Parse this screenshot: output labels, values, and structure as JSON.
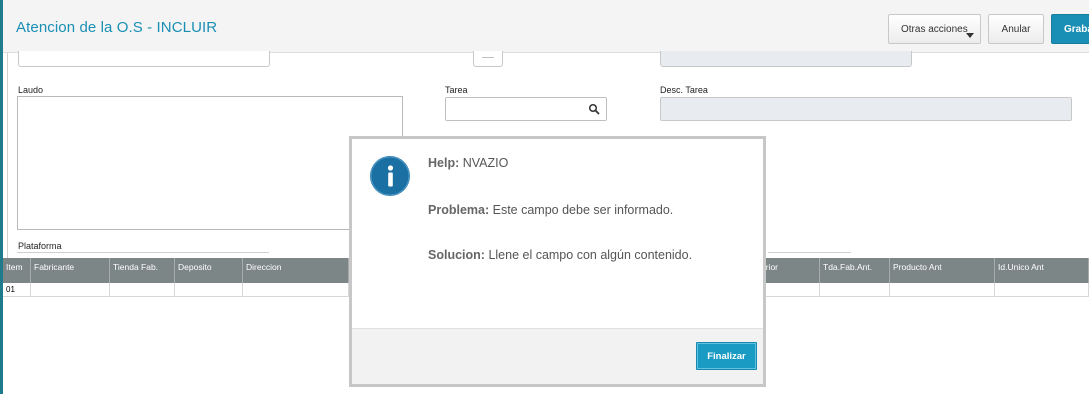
{
  "header": {
    "title": "Atencion de la O.S - INCLUIR",
    "otras_acciones_label": "Otras acciones",
    "anular_label": "Anular",
    "grabar_label": "Graba"
  },
  "form": {
    "top_field_value": "___",
    "laudo_label": "Laudo",
    "tarea_label": "Tarea",
    "tarea_value": "",
    "desc_tarea_label": "Desc. Tarea",
    "desc_tarea_value": "",
    "plataforma_label": "Plataforma"
  },
  "grid": {
    "columns": [
      "Item",
      "Fabricante",
      "Tienda Fab.",
      "Deposito",
      "Direccion",
      "erior",
      "Tda.Fab.Ant.",
      "Producto Ant",
      "Id.Unico Ant"
    ],
    "rows": [
      {
        "item": "01"
      }
    ]
  },
  "modal": {
    "help_label": "Help:",
    "help_value": "NVAZIO",
    "problema_label": "Problema:",
    "problema_value": "Este campo debe ser informado.",
    "solucion_label": "Solucion:",
    "solucion_value": "Llene el campo con algún contenido.",
    "finalizar_label": "Finalizar"
  },
  "icons": {
    "info": "info-icon",
    "search": "search-icon",
    "dropdown": "chevron-down-icon"
  },
  "colors": {
    "accent": "#1a8fb5",
    "info_circle": "#1a6fa3",
    "grid_header": "#7d8687",
    "finalizar": "#1a9bc4"
  }
}
